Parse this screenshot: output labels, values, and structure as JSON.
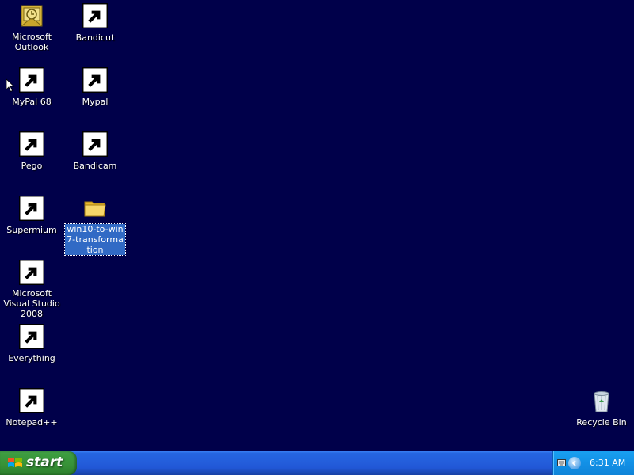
{
  "desktop": {
    "background_color": "#00004a",
    "icons": [
      {
        "label": "Microsoft Outlook",
        "icon": "outlook-icon"
      },
      {
        "label": "Bandicut",
        "icon": "bandicut-icon"
      },
      {
        "label": "MyPal 68",
        "icon": "mypal-icon"
      },
      {
        "label": "Mypal",
        "icon": "mypal-icon"
      },
      {
        "label": "Pego",
        "icon": "window-app-icon"
      },
      {
        "label": "Bandicam",
        "icon": "bandicam-icon"
      },
      {
        "label": "Supermium",
        "icon": "supermium-icon"
      },
      {
        "label": "win10-to-win7-transformation",
        "icon": "folder-icon",
        "selected": true
      },
      {
        "label": "Microsoft Visual Studio 2008",
        "icon": "visual-studio-icon"
      },
      {
        "label": "Everything",
        "icon": "everything-search-icon"
      },
      {
        "label": "Notepad++",
        "icon": "notepad-plus-plus-icon"
      },
      {
        "label": "Recycle Bin",
        "icon": "recycle-bin-icon"
      }
    ]
  },
  "taskbar": {
    "start_label": "start",
    "clock": "6:31 AM",
    "colors": {
      "taskbar": "#245edb",
      "start": "#3c9c3f",
      "tray": "#1290e6"
    }
  }
}
